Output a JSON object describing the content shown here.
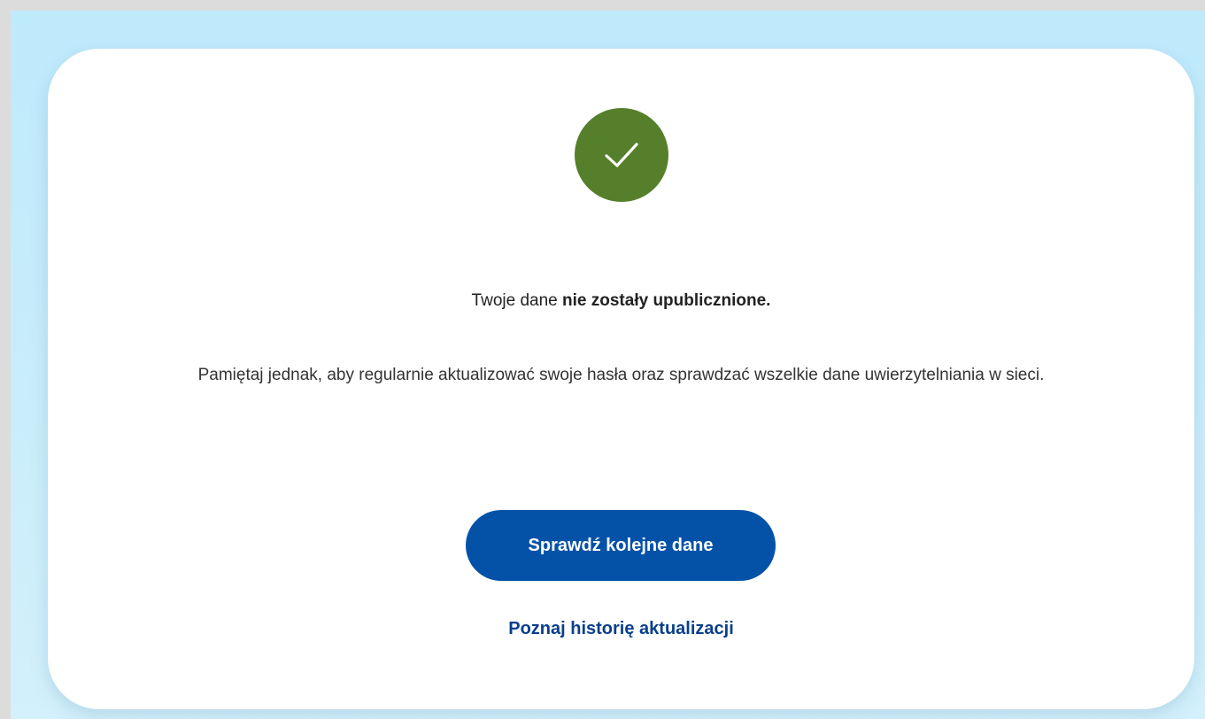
{
  "result": {
    "headline_prefix": "Twoje dane ",
    "headline_bold": "nie zostały upublicznione.",
    "note": "Pamiętaj jednak, aby regularnie aktualizować swoje hasła oraz sprawdzać wszelkie dane uwierzytelniania w sieci."
  },
  "actions": {
    "check_again_label": "Sprawdź kolejne dane",
    "history_link_label": "Poznaj historię aktualizacji"
  },
  "icons": {
    "status": "checkmark-icon"
  },
  "colors": {
    "success": "#557f2a",
    "primary": "#0452a8",
    "link": "#0a3f8c"
  }
}
